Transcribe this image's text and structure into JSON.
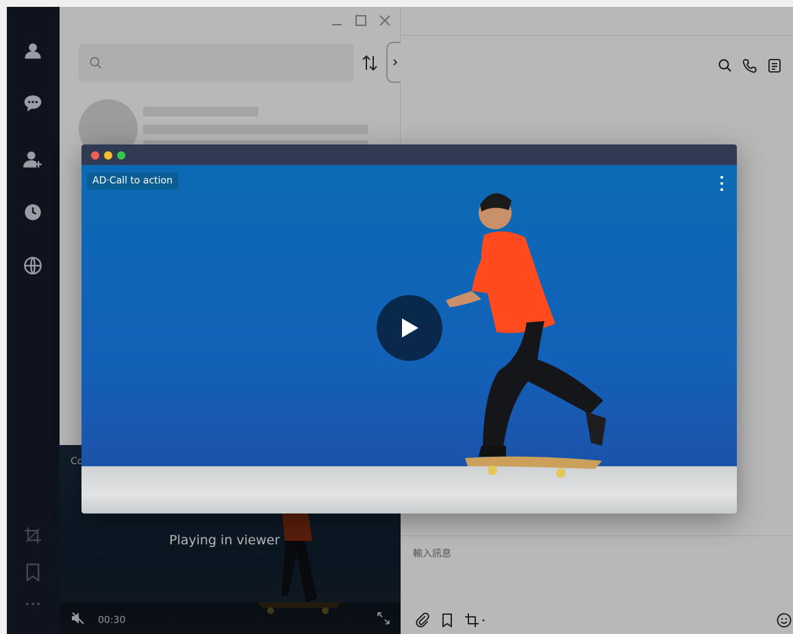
{
  "window": {
    "minimize_icon": "minimize-icon",
    "maximize_icon": "maximize-icon",
    "close_icon": "close-icon"
  },
  "sidebar": {
    "items": [
      {
        "name": "friends",
        "icon": "person-icon"
      },
      {
        "name": "chats",
        "icon": "chat-bubble-icon"
      },
      {
        "name": "add-friend",
        "icon": "add-person-icon"
      },
      {
        "name": "timeline",
        "icon": "clock-icon"
      },
      {
        "name": "discover",
        "icon": "globe-icon"
      }
    ],
    "bottom_items": [
      {
        "name": "screenshot",
        "icon": "crop-icon"
      },
      {
        "name": "keep",
        "icon": "bookmark-icon"
      },
      {
        "name": "more",
        "icon": "more-horizontal-icon"
      }
    ]
  },
  "chat_list": {
    "search": {
      "placeholder": ""
    },
    "mini_player": {
      "title": "Co",
      "status": "Playing in viewer",
      "time": "00:30"
    }
  },
  "conversation": {
    "header_icons": [
      "search-icon",
      "phone-icon",
      "notes-icon"
    ],
    "composer": {
      "placeholder": "輸入訊息"
    },
    "composer_icons": [
      "paperclip-icon",
      "bookmark-icon",
      "crop-icon",
      "emoji-icon"
    ]
  },
  "viewer": {
    "traffic_lights": {
      "close": "#ee5f57",
      "minimize": "#f5bd2f",
      "zoom": "#37c84a"
    },
    "ad_label": "AD·Call to action",
    "background": "#0c6ab4"
  },
  "colors": {
    "rail": "#141b2a",
    "viewer_bar": "#303a52"
  }
}
